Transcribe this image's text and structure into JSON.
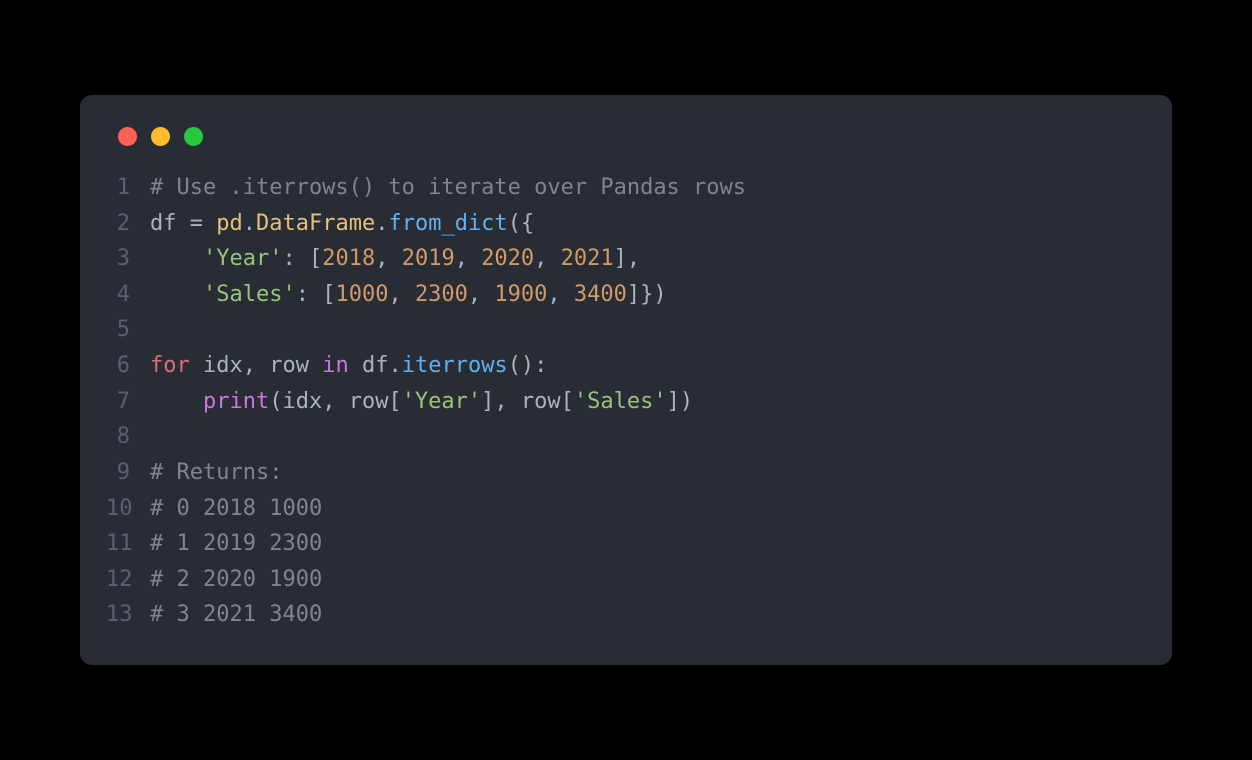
{
  "window": {
    "traffic_lights": [
      "close",
      "minimize",
      "zoom"
    ]
  },
  "code": {
    "language": "python",
    "lines": [
      {
        "num": "1",
        "tokens": [
          {
            "t": "# Use .iterrows() to iterate over Pandas rows",
            "c": "tok-comment"
          }
        ]
      },
      {
        "num": "2",
        "tokens": [
          {
            "t": "df ",
            "c": "tok-var"
          },
          {
            "t": "=",
            "c": "tok-op"
          },
          {
            "t": " pd",
            "c": "tok-name"
          },
          {
            "t": ".",
            "c": "tok-punct"
          },
          {
            "t": "DataFrame",
            "c": "tok-name"
          },
          {
            "t": ".",
            "c": "tok-punct"
          },
          {
            "t": "from_dict",
            "c": "tok-func"
          },
          {
            "t": "({",
            "c": "tok-punct"
          }
        ]
      },
      {
        "num": "3",
        "tokens": [
          {
            "t": "    ",
            "c": "tok-var"
          },
          {
            "t": "'Year'",
            "c": "tok-string"
          },
          {
            "t": ": [",
            "c": "tok-punct"
          },
          {
            "t": "2018",
            "c": "tok-number"
          },
          {
            "t": ", ",
            "c": "tok-punct"
          },
          {
            "t": "2019",
            "c": "tok-number"
          },
          {
            "t": ", ",
            "c": "tok-punct"
          },
          {
            "t": "2020",
            "c": "tok-number"
          },
          {
            "t": ", ",
            "c": "tok-punct"
          },
          {
            "t": "2021",
            "c": "tok-number"
          },
          {
            "t": "],",
            "c": "tok-punct"
          }
        ]
      },
      {
        "num": "4",
        "tokens": [
          {
            "t": "    ",
            "c": "tok-var"
          },
          {
            "t": "'Sales'",
            "c": "tok-string"
          },
          {
            "t": ": [",
            "c": "tok-punct"
          },
          {
            "t": "1000",
            "c": "tok-number"
          },
          {
            "t": ", ",
            "c": "tok-punct"
          },
          {
            "t": "2300",
            "c": "tok-number"
          },
          {
            "t": ", ",
            "c": "tok-punct"
          },
          {
            "t": "1900",
            "c": "tok-number"
          },
          {
            "t": ", ",
            "c": "tok-punct"
          },
          {
            "t": "3400",
            "c": "tok-number"
          },
          {
            "t": "]})",
            "c": "tok-punct"
          }
        ]
      },
      {
        "num": "5",
        "tokens": []
      },
      {
        "num": "6",
        "tokens": [
          {
            "t": "for",
            "c": "tok-keyword2"
          },
          {
            "t": " idx",
            "c": "tok-var"
          },
          {
            "t": ",",
            "c": "tok-punct"
          },
          {
            "t": " row ",
            "c": "tok-var"
          },
          {
            "t": "in",
            "c": "tok-keyword"
          },
          {
            "t": " df",
            "c": "tok-var"
          },
          {
            "t": ".",
            "c": "tok-punct"
          },
          {
            "t": "iterrows",
            "c": "tok-func"
          },
          {
            "t": "():",
            "c": "tok-punct"
          }
        ]
      },
      {
        "num": "7",
        "tokens": [
          {
            "t": "    ",
            "c": "tok-var"
          },
          {
            "t": "print",
            "c": "tok-keyword"
          },
          {
            "t": "(idx",
            "c": "tok-var"
          },
          {
            "t": ",",
            "c": "tok-punct"
          },
          {
            "t": " row[",
            "c": "tok-var"
          },
          {
            "t": "'Year'",
            "c": "tok-string"
          },
          {
            "t": "]",
            "c": "tok-punct"
          },
          {
            "t": ",",
            "c": "tok-punct"
          },
          {
            "t": " row[",
            "c": "tok-var"
          },
          {
            "t": "'Sales'",
            "c": "tok-string"
          },
          {
            "t": "])",
            "c": "tok-punct"
          }
        ]
      },
      {
        "num": "8",
        "tokens": []
      },
      {
        "num": "9",
        "tokens": [
          {
            "t": "# Returns:",
            "c": "tok-comment"
          }
        ]
      },
      {
        "num": "10",
        "tokens": [
          {
            "t": "# 0 2018 1000",
            "c": "tok-comment"
          }
        ]
      },
      {
        "num": "11",
        "tokens": [
          {
            "t": "# 1 2019 2300",
            "c": "tok-comment"
          }
        ]
      },
      {
        "num": "12",
        "tokens": [
          {
            "t": "# 2 2020 1900",
            "c": "tok-comment"
          }
        ]
      },
      {
        "num": "13",
        "tokens": [
          {
            "t": "# 3 2021 3400",
            "c": "tok-comment"
          }
        ]
      }
    ]
  }
}
